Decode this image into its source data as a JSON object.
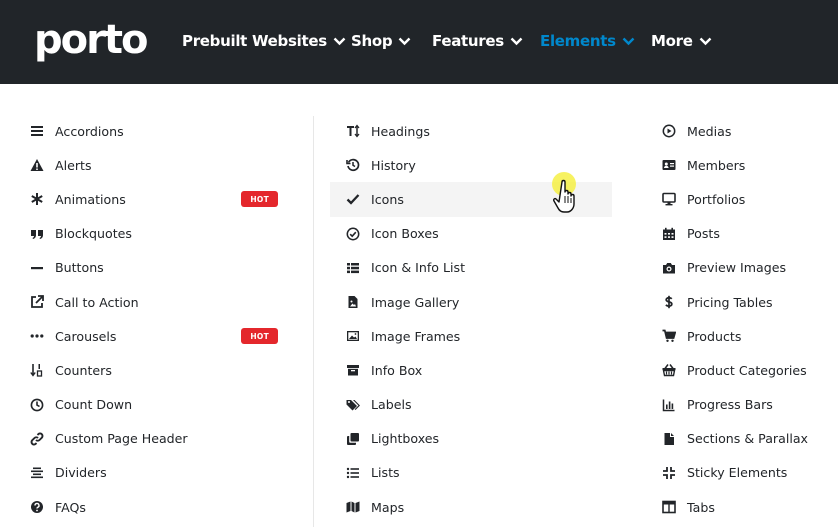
{
  "brand": {
    "logo_text": "porto"
  },
  "nav": {
    "items": [
      {
        "label": "Prebuilt Websites"
      },
      {
        "label": "Shop"
      },
      {
        "label": "Features"
      },
      {
        "label": "Elements",
        "active": true
      },
      {
        "label": "More"
      }
    ],
    "active_color": "#0088cc",
    "header_bg": "#212529"
  },
  "menu": {
    "col1": [
      {
        "label": "Accordions",
        "icon": "bars-icon"
      },
      {
        "label": "Alerts",
        "icon": "warning-icon"
      },
      {
        "label": "Animations",
        "icon": "asterisk-icon",
        "badge": "HOT"
      },
      {
        "label": "Blockquotes",
        "icon": "quote-icon"
      },
      {
        "label": "Buttons",
        "icon": "minus-icon"
      },
      {
        "label": "Call to Action",
        "icon": "external-link-icon"
      },
      {
        "label": "Carousels",
        "icon": "ellipsis-icon",
        "badge": "HOT"
      },
      {
        "label": "Counters",
        "icon": "sort-numeric-icon"
      },
      {
        "label": "Count Down",
        "icon": "clock-icon"
      },
      {
        "label": "Custom Page Header",
        "icon": "link-icon"
      },
      {
        "label": "Dividers",
        "icon": "align-center-icon"
      },
      {
        "label": "FAQs",
        "icon": "question-circle-icon"
      }
    ],
    "col2": [
      {
        "label": "Headings",
        "icon": "text-height-icon"
      },
      {
        "label": "History",
        "icon": "history-icon"
      },
      {
        "label": "Icons",
        "icon": "check-icon",
        "hover": true
      },
      {
        "label": "Icon Boxes",
        "icon": "check-circle-icon"
      },
      {
        "label": "Icon & Info List",
        "icon": "list-table-icon"
      },
      {
        "label": "Image Gallery",
        "icon": "file-image-icon"
      },
      {
        "label": "Image Frames",
        "icon": "image-icon"
      },
      {
        "label": "Info Box",
        "icon": "archive-icon"
      },
      {
        "label": "Labels",
        "icon": "tags-icon"
      },
      {
        "label": "Lightboxes",
        "icon": "clone-icon"
      },
      {
        "label": "Lists",
        "icon": "list-ul-icon"
      },
      {
        "label": "Maps",
        "icon": "map-icon"
      }
    ],
    "col3": [
      {
        "label": "Medias",
        "icon": "play-circle-icon"
      },
      {
        "label": "Members",
        "icon": "id-card-icon"
      },
      {
        "label": "Portfolios",
        "icon": "desktop-icon"
      },
      {
        "label": "Posts",
        "icon": "calendar-icon"
      },
      {
        "label": "Preview Images",
        "icon": "camera-icon"
      },
      {
        "label": "Pricing Tables",
        "icon": "dollar-icon"
      },
      {
        "label": "Products",
        "icon": "cart-icon"
      },
      {
        "label": "Product Categories",
        "icon": "basket-icon"
      },
      {
        "label": "Progress Bars",
        "icon": "bar-chart-icon"
      },
      {
        "label": "Sections & Parallax",
        "icon": "file-icon"
      },
      {
        "label": "Sticky Elements",
        "icon": "compress-icon"
      },
      {
        "label": "Tabs",
        "icon": "window-icon"
      }
    ],
    "badge_color": "#e4272c"
  }
}
